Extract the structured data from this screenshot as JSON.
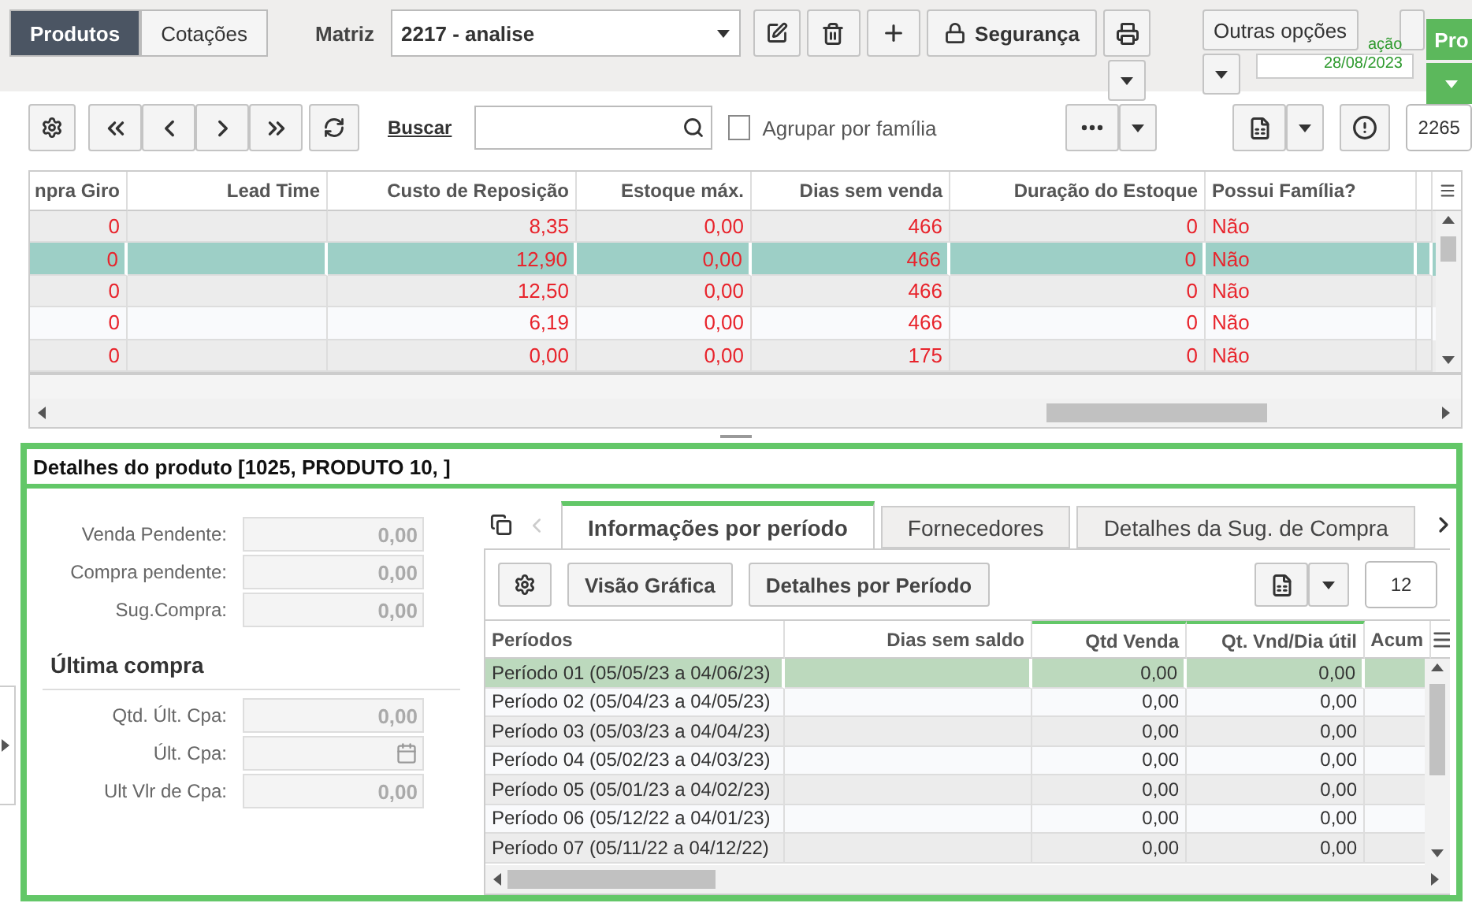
{
  "top_tabs": [
    {
      "label": "Produtos",
      "selected": true
    },
    {
      "label": "Cotações",
      "selected": false
    }
  ],
  "matrix": {
    "label": "Matriz",
    "value": "2217 - analise"
  },
  "top_buttons": {
    "security": "Segurança",
    "other_options": "Outras opções"
  },
  "overlay": {
    "status_text": "ação",
    "date": "28/08/2023",
    "action": "Pro"
  },
  "toolbar": {
    "search_link": "Buscar",
    "group_label": "Agrupar por família",
    "group_checked": false,
    "count": "2265"
  },
  "table": {
    "columns": [
      "npra Giro",
      "Lead Time",
      "Custo de Reposição",
      "Estoque máx.",
      "Dias sem venda",
      "Duração do Estoque",
      "Possui Família?"
    ],
    "rows": [
      {
        "selected": false,
        "cells": [
          "0",
          "",
          "8,35",
          "0,00",
          "466",
          "0",
          "Não"
        ]
      },
      {
        "selected": true,
        "cells": [
          "0",
          "",
          "12,90",
          "0,00",
          "466",
          "0",
          "Não"
        ]
      },
      {
        "selected": false,
        "cells": [
          "0",
          "",
          "12,50",
          "0,00",
          "466",
          "0",
          "Não"
        ]
      },
      {
        "selected": false,
        "cells": [
          "0",
          "",
          "6,19",
          "0,00",
          "466",
          "0",
          "Não"
        ]
      },
      {
        "selected": false,
        "cells": [
          "0",
          "",
          "0,00",
          "0,00",
          "175",
          "0",
          "Não"
        ]
      }
    ]
  },
  "details": {
    "title": "Detalhes do produto [1025, PRODUTO 10, ]",
    "fields": [
      {
        "label": "Venda Pendente:",
        "value": "0,00",
        "kind": "number",
        "disabled": true
      },
      {
        "label": "Compra pendente:",
        "value": "0,00",
        "kind": "number",
        "disabled": true
      },
      {
        "label": "Sug.Compra:",
        "value": "0,00",
        "kind": "number",
        "disabled": true
      }
    ],
    "last_purchase_title": "Última compra",
    "last_purchase_fields": [
      {
        "label": "Qtd. Últ. Cpa:",
        "value": "0,00",
        "kind": "number",
        "disabled": true
      },
      {
        "label": "Últ. Cpa:",
        "kind": "date",
        "disabled": true
      },
      {
        "label": "Ult Vlr de Cpa:",
        "value": "0,00",
        "kind": "number",
        "disabled": true
      }
    ],
    "tabs": [
      {
        "label": "Informações por período",
        "selected": true
      },
      {
        "label": "Fornecedores",
        "selected": false
      },
      {
        "label": "Detalhes da Sug. de Compra",
        "selected": false
      }
    ],
    "buttons": [
      "Visão Gráfica",
      "Detalhes por Período"
    ],
    "count": "12",
    "grid": {
      "columns": [
        "Períodos",
        "Dias sem saldo",
        "Qtd Venda",
        "Qt. Vnd/Dia útil",
        "Acum"
      ],
      "rows": [
        {
          "selected": true,
          "cells": [
            "Período 01 (05/05/23 a 04/06/23)",
            "",
            "0,00",
            "0,00",
            ""
          ]
        },
        {
          "selected": false,
          "cells": [
            "Período 02 (05/04/23 a 04/05/23)",
            "",
            "0,00",
            "0,00",
            ""
          ]
        },
        {
          "selected": false,
          "cells": [
            "Período 03 (05/03/23 a 04/04/23)",
            "",
            "0,00",
            "0,00",
            ""
          ]
        },
        {
          "selected": false,
          "cells": [
            "Período 04 (05/02/23 a 04/03/23)",
            "",
            "0,00",
            "0,00",
            ""
          ]
        },
        {
          "selected": false,
          "cells": [
            "Período 05 (05/01/23 a 04/02/23)",
            "",
            "0,00",
            "0,00",
            ""
          ]
        },
        {
          "selected": false,
          "cells": [
            "Período 06 (05/12/22 a 04/01/23)",
            "",
            "0,00",
            "0,00",
            ""
          ]
        },
        {
          "selected": false,
          "cells": [
            "Período 07 (05/11/22 a 04/12/22)",
            "",
            "0,00",
            "0,00",
            ""
          ]
        }
      ]
    }
  }
}
